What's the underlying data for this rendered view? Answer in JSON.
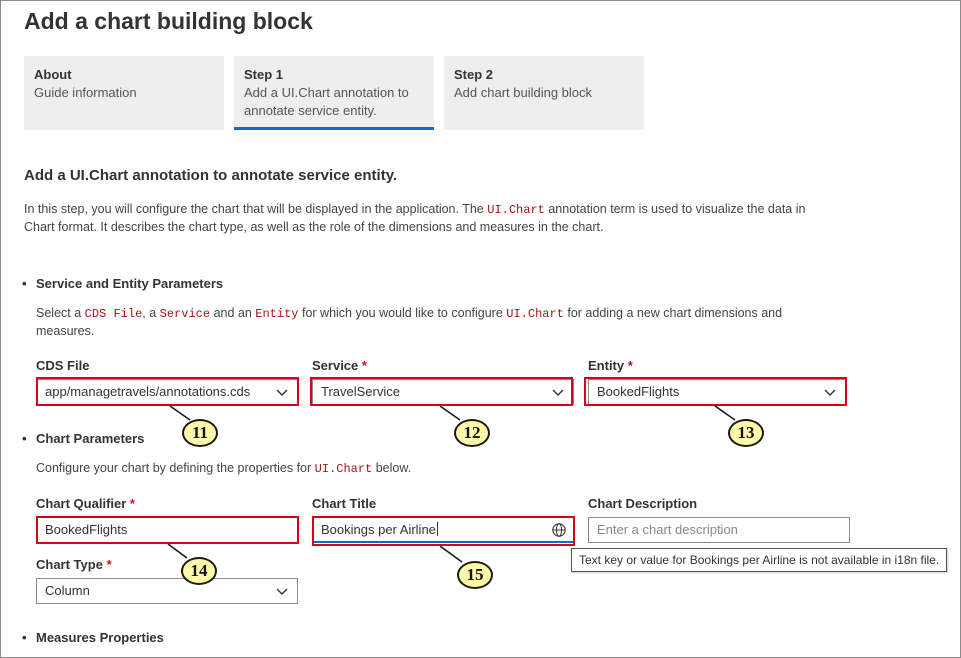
{
  "page": {
    "title": "Add a chart building block"
  },
  "steps": [
    {
      "title": "About",
      "desc": "Guide information"
    },
    {
      "title": "Step 1",
      "desc": "Add a UI.Chart annotation to annotate service entity."
    },
    {
      "title": "Step 2",
      "desc": "Add chart building block"
    }
  ],
  "section": {
    "title": "Add a UI.Chart annotation to annotate service entity.",
    "intro_1": "In this step, you will configure the chart that will be displayed in the application. The",
    "intro_code": "UI.Chart",
    "intro_2": "annotation term is used to visualize the data in Chart format. It describes the chart type, as well as the role of the dimensions and measures in the chart."
  },
  "service_params": {
    "heading": "Service and Entity Parameters",
    "desc_1": "Select a",
    "desc_code_1": "CDS File",
    "desc_2": ", a",
    "desc_code_2": "Service",
    "desc_3": "and an",
    "desc_code_3": "Entity",
    "desc_4": "for which you would like to configure",
    "desc_code_4": "UI.Chart",
    "desc_5": "for adding a new chart dimensions and measures.",
    "cds_label": "CDS File",
    "cds_value": "app/managetravels/annotations.cds",
    "service_label": "Service",
    "service_value": "TravelService",
    "entity_label": "Entity",
    "entity_value": "BookedFlights",
    "required_mark": "*"
  },
  "chart_params": {
    "heading": "Chart Parameters",
    "desc_1": "Configure your chart by defining the properties for",
    "desc_code": "UI.Chart",
    "desc_2": "below.",
    "qualifier_label": "Chart Qualifier",
    "qualifier_value": "BookedFlights",
    "title_label": "Chart Title",
    "title_value": "Bookings per Airline",
    "description_label": "Chart Description",
    "description_placeholder": "Enter a chart description",
    "type_label": "Chart Type",
    "type_value": "Column",
    "tooltip": "Text key or value for Bookings per Airline is not available in i18n file."
  },
  "measures": {
    "heading": "Measures Properties"
  },
  "callouts": [
    "11",
    "12",
    "13",
    "14",
    "15"
  ],
  "colors": {
    "accent": "#0e6cc5",
    "highlight": "#d9001b",
    "callout_fill": "#fff9a8",
    "code": "#a31515"
  }
}
